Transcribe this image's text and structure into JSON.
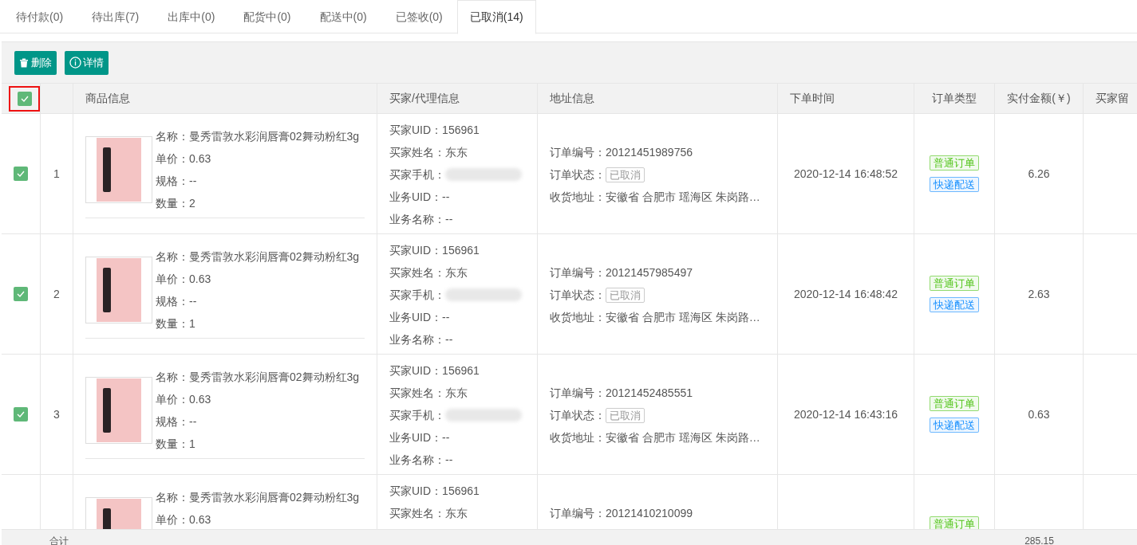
{
  "tabs": [
    {
      "label": "待付款(0)",
      "selected": false
    },
    {
      "label": "待出库(7)",
      "selected": false
    },
    {
      "label": "出库中(0)",
      "selected": false
    },
    {
      "label": "配货中(0)",
      "selected": false
    },
    {
      "label": "配送中(0)",
      "selected": false
    },
    {
      "label": "已签收(0)",
      "selected": false
    },
    {
      "label": "已取消(14)",
      "selected": true
    }
  ],
  "toolbar": [
    {
      "label": "删除",
      "kind": "delete"
    },
    {
      "label": "详情",
      "kind": "info"
    }
  ],
  "table": {
    "select_all_checked": true,
    "columns": [
      "商品信息",
      "买家/代理信息",
      "地址信息",
      "下单时间",
      "订单类型",
      "实付金额(￥)",
      "买家留"
    ],
    "rows": [
      {
        "checked": true,
        "index": "1",
        "product": [
          "名称：曼秀雷敦水彩润唇膏02舞动粉红3g",
          "单价：0.63",
          "规格：--",
          "数量：2"
        ],
        "buyer": [
          {
            "kind": "text",
            "text": "买家UID：156961"
          },
          {
            "kind": "text",
            "text": "买家姓名：东东"
          },
          {
            "kind": "phone",
            "text": "买家手机："
          },
          {
            "kind": "text",
            "text": "业务UID：--"
          },
          {
            "kind": "text",
            "text": "业务名称：--"
          }
        ],
        "address": [
          {
            "kind": "text",
            "text": "订单编号：20121451989756"
          },
          {
            "kind": "status",
            "text": "订单状态：",
            "badge": "已取消"
          },
          {
            "kind": "text",
            "text": "收货地址：安徽省 合肥市 瑶海区 朱岗路…"
          }
        ],
        "time": "2020-12-14 16:48:52",
        "types": [
          {
            "label": "普通订单",
            "color": "#52c41a"
          },
          {
            "label": "快递配送",
            "color": "#1890ff"
          }
        ],
        "amount": "6.26"
      },
      {
        "checked": true,
        "index": "2",
        "product": [
          "名称：曼秀雷敦水彩润唇膏02舞动粉红3g",
          "单价：0.63",
          "规格：--",
          "数量：1"
        ],
        "buyer": [
          {
            "kind": "text",
            "text": "买家UID：156961"
          },
          {
            "kind": "text",
            "text": "买家姓名：东东"
          },
          {
            "kind": "phone",
            "text": "买家手机："
          },
          {
            "kind": "text",
            "text": "业务UID：--"
          },
          {
            "kind": "text",
            "text": "业务名称：--"
          }
        ],
        "address": [
          {
            "kind": "text",
            "text": "订单编号：20121457985497"
          },
          {
            "kind": "status",
            "text": "订单状态：",
            "badge": "已取消"
          },
          {
            "kind": "text",
            "text": "收货地址：安徽省 合肥市 瑶海区 朱岗路…"
          }
        ],
        "time": "2020-12-14 16:48:42",
        "types": [
          {
            "label": "普通订单",
            "color": "#52c41a"
          },
          {
            "label": "快递配送",
            "color": "#1890ff"
          }
        ],
        "amount": "2.63"
      },
      {
        "checked": true,
        "index": "3",
        "product": [
          "名称：曼秀雷敦水彩润唇膏02舞动粉红3g",
          "单价：0.63",
          "规格：--",
          "数量：1"
        ],
        "buyer": [
          {
            "kind": "text",
            "text": "买家UID：156961"
          },
          {
            "kind": "text",
            "text": "买家姓名：东东"
          },
          {
            "kind": "phone",
            "text": "买家手机："
          },
          {
            "kind": "text",
            "text": "业务UID：--"
          },
          {
            "kind": "text",
            "text": "业务名称：--"
          }
        ],
        "address": [
          {
            "kind": "text",
            "text": "订单编号：20121452485551"
          },
          {
            "kind": "status",
            "text": "订单状态：",
            "badge": "已取消"
          },
          {
            "kind": "text",
            "text": "收货地址：安徽省 合肥市 瑶海区 朱岗路…"
          }
        ],
        "time": "2020-12-14 16:43:16",
        "types": [
          {
            "label": "普通订单",
            "color": "#52c41a"
          },
          {
            "label": "快递配送",
            "color": "#1890ff"
          }
        ],
        "amount": "0.63"
      },
      {
        "index": "",
        "product": [
          "名称：曼秀雷敦水彩润唇膏02舞动粉红3g",
          "单价：0.63"
        ],
        "buyer": [
          {
            "kind": "text",
            "text": "买家UID：156961"
          },
          {
            "kind": "text",
            "text": "买家姓名：东东"
          }
        ],
        "address": [
          {
            "kind": "text",
            "text": "订单编号：20121410210099"
          }
        ],
        "types": [
          {
            "label": "普通订单",
            "color": "#52c41a"
          }
        ]
      }
    ],
    "footer": {
      "label": "合计",
      "amount": "285.15"
    }
  }
}
